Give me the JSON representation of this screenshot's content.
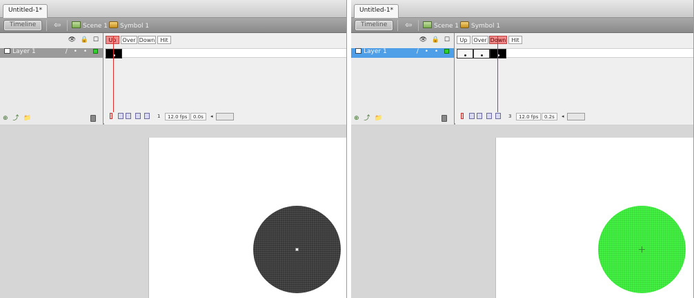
{
  "left_panel": {
    "doc_tab": "Untitled-1*",
    "timeline_button": "Timeline",
    "back_icon": "back-arrow-icon",
    "scene_label": "Scene 1",
    "symbol_label": "Symbol 1",
    "layer_name": "Layer 1",
    "frame_labels": [
      "Up",
      "Over",
      "Down",
      "Hit"
    ],
    "current_frame_label": "Up",
    "status": {
      "frame": "1",
      "fps": "12.0 fps",
      "time": "0.0s"
    },
    "circle_color": "#414141"
  },
  "right_panel": {
    "doc_tab": "Untitled-1*",
    "timeline_button": "Timeline",
    "back_icon": "back-arrow-icon",
    "scene_label": "Scene 1",
    "symbol_label": "Symbol 1",
    "layer_name": "Layer 1",
    "frame_labels": [
      "Up",
      "Over",
      "Down",
      "Hit"
    ],
    "current_frame_label": "Down",
    "status": {
      "frame": "3",
      "fps": "12.0 fps",
      "time": "0.2s"
    },
    "circle_color": "#3bec3b"
  },
  "colors": {
    "selected_layer": "#4f9ee8",
    "inactive_layer": "#9a9a9a",
    "playhead": "#e02a2a",
    "current_frame_label_bg": "#f08a8a",
    "outline_square": "#30d030"
  }
}
